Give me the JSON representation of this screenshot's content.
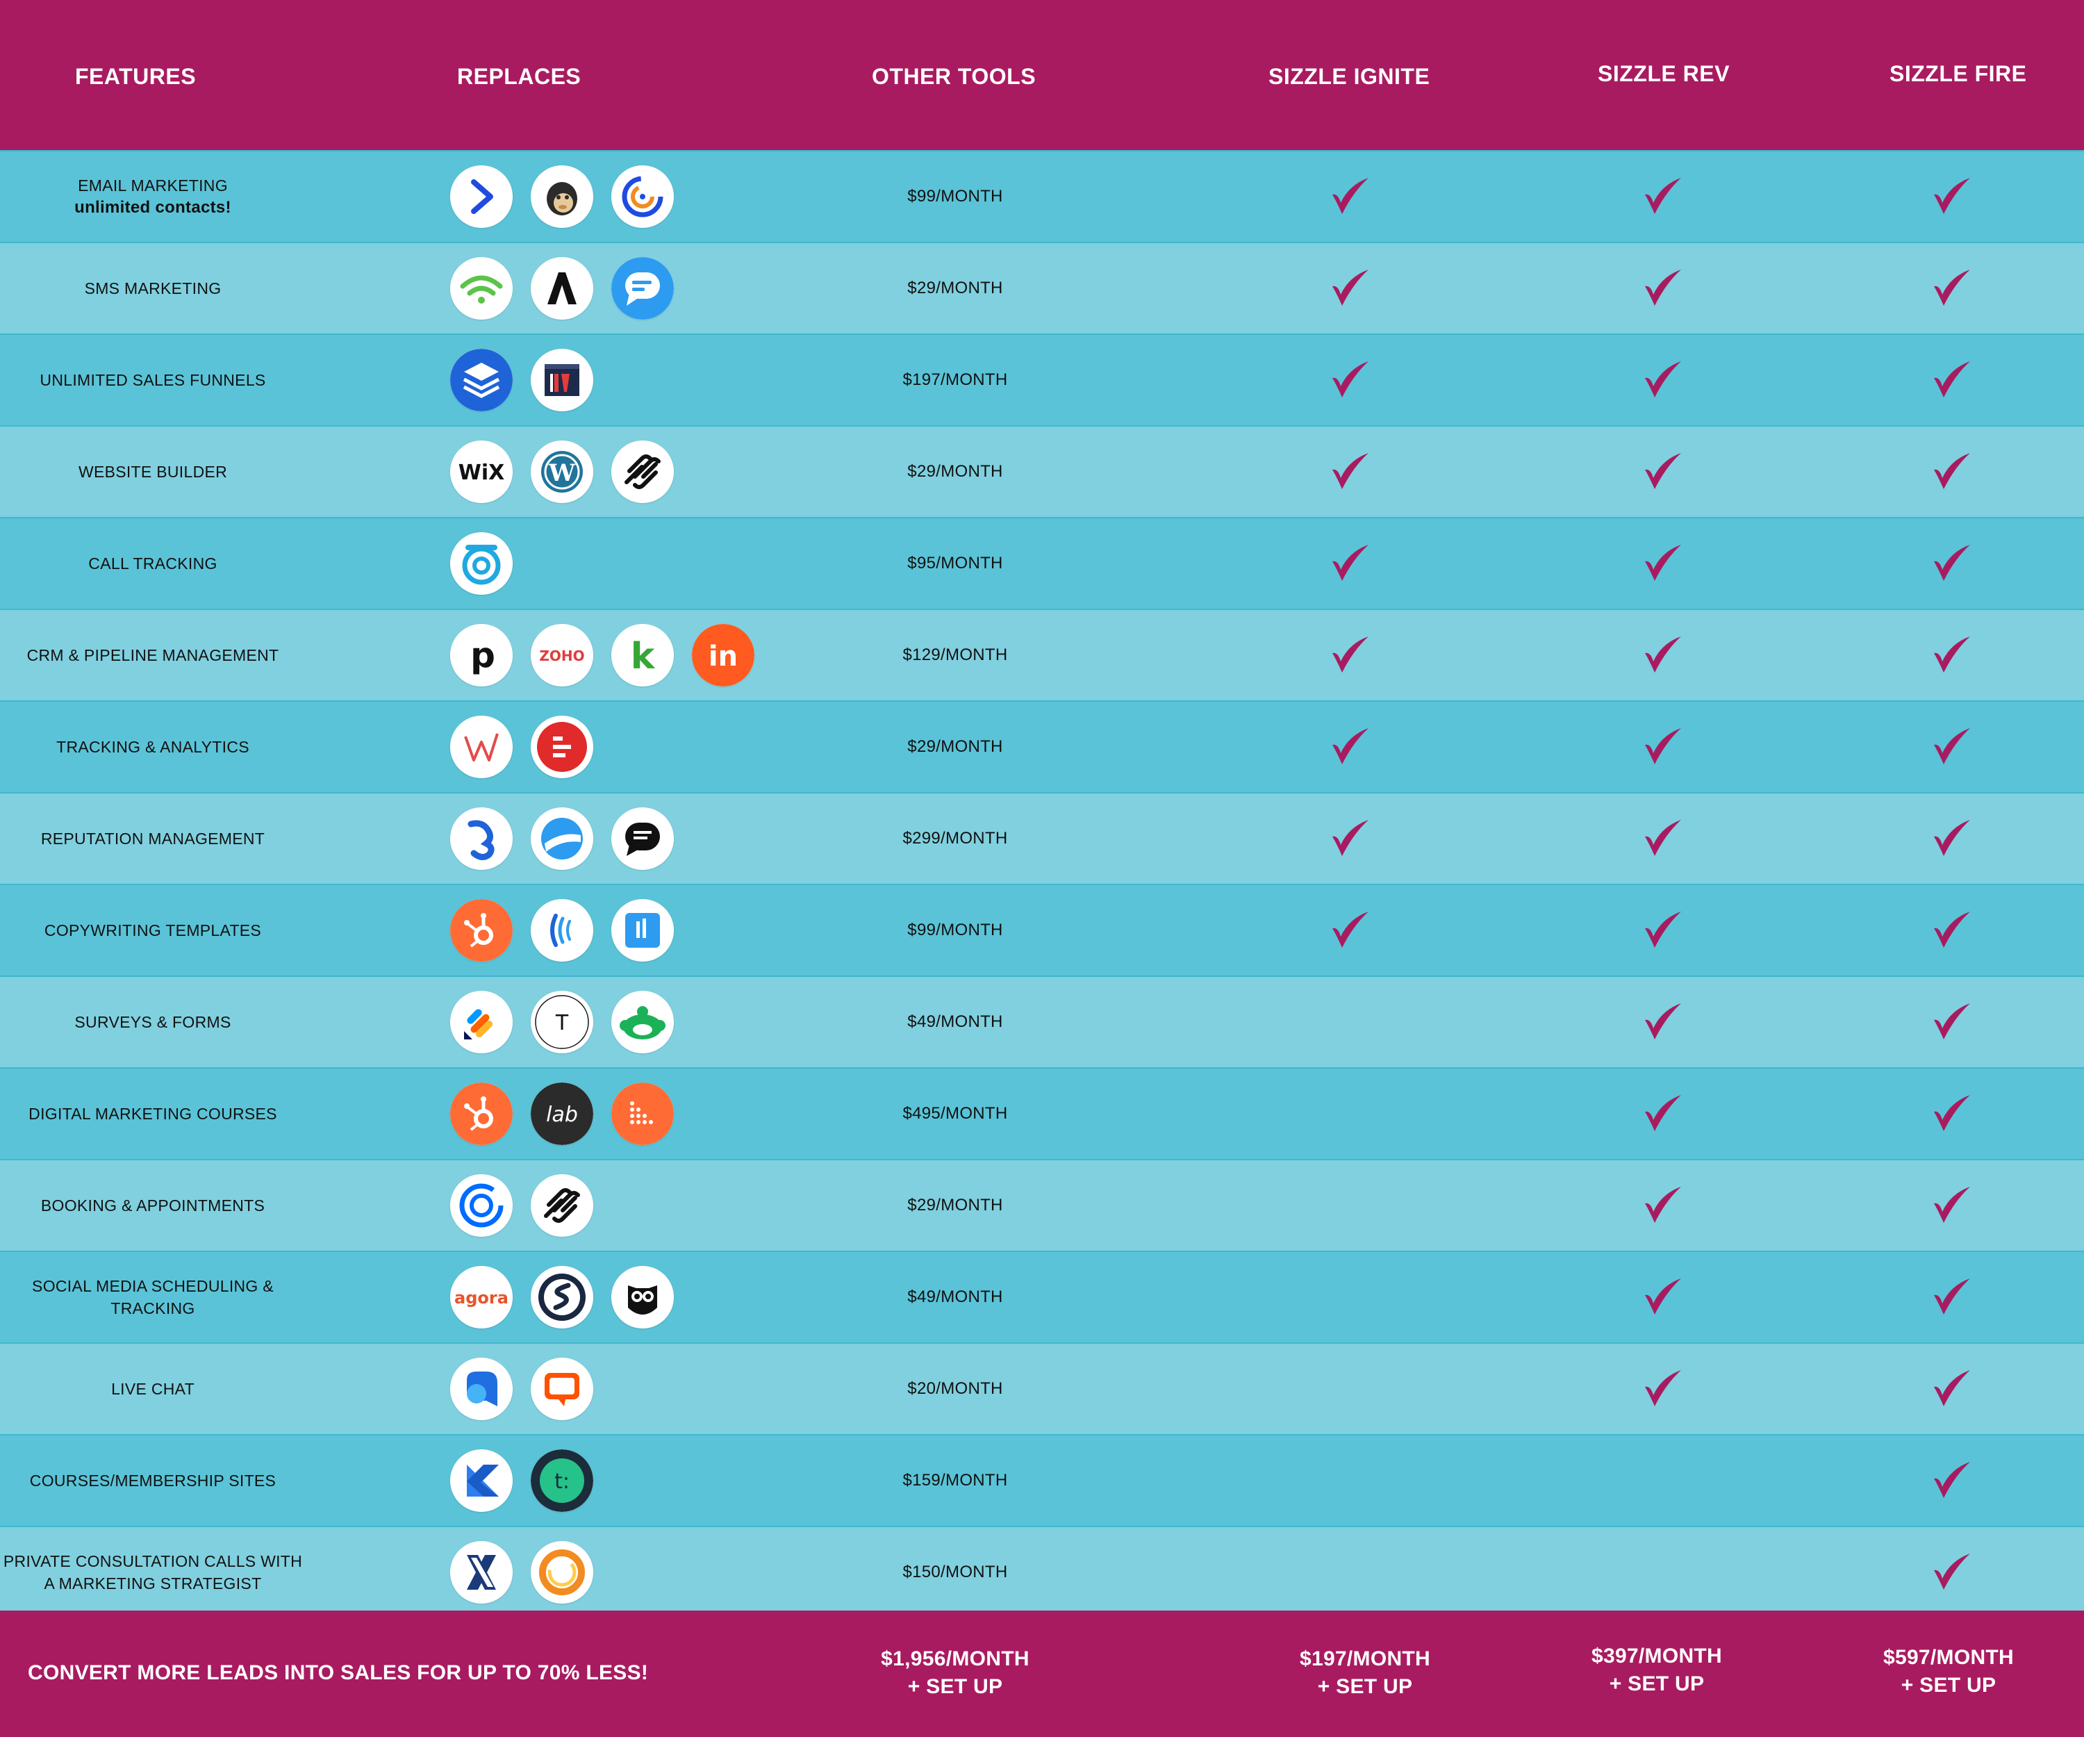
{
  "colors": {
    "brand": "#a91b60",
    "row_dark": "#5ac3d7",
    "row_light": "#80d0df",
    "check": "#a91b60"
  },
  "header": {
    "features": "FEATURES",
    "replaces": "REPLACES",
    "other_tools": "OTHER TOOLS",
    "plan_ignite": "SIZZLE IGNITE",
    "plan_rev": "SIZZLE REV",
    "plan_fire": "SIZZLE FIRE"
  },
  "rows": [
    {
      "feature": "EMAIL MARKETING",
      "feature_sub": "unlimited contacts!",
      "price": "$99/MONTH",
      "ignite": true,
      "rev": true,
      "fire": true,
      "logos": [
        "activecampaign-icon",
        "mailchimp-icon",
        "constant-contact-icon"
      ]
    },
    {
      "feature": "SMS MARKETING",
      "feature_sub": "",
      "price": "$29/MONTH",
      "ignite": true,
      "rev": true,
      "fire": true,
      "logos": [
        "wifi-signal-icon",
        "attentive-icon",
        "chat-bubble-icon"
      ]
    },
    {
      "feature": "UNLIMITED SALES FUNNELS",
      "feature_sub": "",
      "price": "$197/MONTH",
      "ignite": true,
      "rev": true,
      "fire": true,
      "logos": [
        "layers-icon",
        "clickfunnels-icon"
      ]
    },
    {
      "feature": "WEBSITE BUILDER",
      "feature_sub": "",
      "price": "$29/MONTH",
      "ignite": true,
      "rev": true,
      "fire": true,
      "logos": [
        "wix-icon",
        "wordpress-icon",
        "squarespace-icon"
      ]
    },
    {
      "feature": "CALL TRACKING",
      "feature_sub": "",
      "price": "$95/MONTH",
      "ignite": true,
      "rev": true,
      "fire": true,
      "logos": [
        "callrail-icon"
      ]
    },
    {
      "feature": "CRM & PIPELINE MANAGEMENT",
      "feature_sub": "",
      "price": "$129/MONTH",
      "ignite": true,
      "rev": true,
      "fire": true,
      "logos": [
        "pipedrive-icon",
        "zoho-icon",
        "keap-icon",
        "insightly-icon"
      ]
    },
    {
      "feature": "TRACKING & ANALYTICS",
      "feature_sub": "",
      "price": "$29/MONTH",
      "ignite": true,
      "rev": true,
      "fire": true,
      "logos": [
        "woopra-icon",
        "analytics-bars-icon"
      ]
    },
    {
      "feature": "REPUTATION MANAGEMENT",
      "feature_sub": "",
      "price": "$299/MONTH",
      "ignite": true,
      "rev": true,
      "fire": true,
      "logos": [
        "birdeye-icon",
        "podium-icon",
        "speech-bubble-icon"
      ]
    },
    {
      "feature": "COPYWRITING TEMPLATES",
      "feature_sub": "",
      "price": "$99/MONTH",
      "ignite": true,
      "rev": true,
      "fire": true,
      "logos": [
        "hubspot-icon",
        "wave-rings-icon",
        "bars-square-icon"
      ]
    },
    {
      "feature": "SURVEYS & FORMS",
      "feature_sub": "",
      "price": "$49/MONTH",
      "ignite": false,
      "rev": true,
      "fire": true,
      "logos": [
        "jotform-icon",
        "typeform-icon",
        "surveymonkey-icon"
      ]
    },
    {
      "feature": "DIGITAL MARKETING COURSES",
      "feature_sub": "",
      "price": "$495/MONTH",
      "ignite": false,
      "rev": true,
      "fire": true,
      "logos": [
        "hubspot-icon",
        "lab-icon",
        "dots-grid-icon"
      ]
    },
    {
      "feature": "BOOKING & APPOINTMENTS",
      "feature_sub": "",
      "price": "$29/MONTH",
      "ignite": false,
      "rev": true,
      "fire": true,
      "logos": [
        "calendly-icon",
        "squarespace-icon"
      ]
    },
    {
      "feature": "SOCIAL MEDIA SCHEDULING &",
      "feature_sub": "TRACKING",
      "price": "$49/MONTH",
      "ignite": false,
      "rev": true,
      "fire": true,
      "logos": [
        "agorapulse-icon",
        "sprout-icon",
        "hootsuite-owl-icon"
      ]
    },
    {
      "feature": "LIVE CHAT",
      "feature_sub": "",
      "price": "$20/MONTH",
      "ignite": false,
      "rev": true,
      "fire": true,
      "logos": [
        "intercom-bubble-icon",
        "livechat-icon"
      ]
    },
    {
      "feature": "COURSES/MEMBERSHIP SITES",
      "feature_sub": "",
      "price": "$159/MONTH",
      "ignite": false,
      "rev": false,
      "fire": true,
      "logos": [
        "kajabi-icon",
        "teachable-icon"
      ]
    },
    {
      "feature": "PRIVATE CONSULTATION CALLS WITH",
      "feature_sub": "A MARKETING STRATEGIST",
      "price": "$150/MONTH",
      "ignite": false,
      "rev": false,
      "fire": true,
      "logos": [
        "x-logo-icon",
        "orange-ring-icon"
      ]
    }
  ],
  "logo_text": {
    "wix": "WiX",
    "zoho": "ZOHO",
    "lab": "lab",
    "agora": "agora",
    "typeform": "T",
    "teachable": "t:",
    "pipedrive": "p",
    "keap": "k",
    "insightly": "in",
    "kajabi": "K",
    "x": "X"
  },
  "footer": {
    "tagline": "CONVERT MORE LEADS INTO SALES FOR UP TO 70% LESS!",
    "other_price": "$1,956/MONTH",
    "other_setup": "+ SET UP",
    "ignite_price": "$197/MONTH",
    "ignite_setup": "+ SET UP",
    "rev_price": "$397/MONTH",
    "rev_setup": "+ SET UP",
    "fire_price": "$597/MONTH",
    "fire_setup": "+ SET UP"
  }
}
